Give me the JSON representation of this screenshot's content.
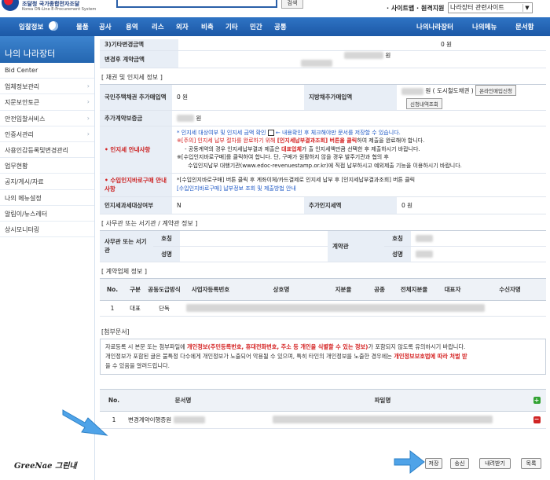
{
  "header": {
    "logo_title": "조달청 국가종합전자조달",
    "logo_subtitle": "Korea ON-Line E-Procurement System",
    "search_button": "검색",
    "top_links": "· 사이트맵 · 원격지원",
    "site_select": "나라장터 관련사이트"
  },
  "nav": {
    "items": [
      "입찰정보",
      "물품",
      "공사",
      "용역",
      "리스",
      "외자",
      "비축",
      "기타",
      "민간",
      "공통",
      "나의나라장터",
      "나의메뉴",
      "문서함"
    ]
  },
  "sidebar": {
    "title": "나의 나라장터",
    "items": [
      "Bid Center",
      "업체정보관리",
      "지문보안토큰",
      "안전입찰서비스",
      "인증서관리",
      "사용인감등록및변경관리",
      "업무현황",
      "공지/게시/자료",
      "나의 메뉴설정",
      "알림이/뉴스레터",
      "상시모니터링"
    ],
    "brand": "GreeNae 그린내"
  },
  "amounts": {
    "other_change_label": "3)기타변경금액",
    "other_change_value": "0 원",
    "after_change_label": "변경후 계약금액",
    "after_change_value": "원"
  },
  "bond": {
    "section_title": "[ 채권 및 인지세 정보 ]",
    "housing_label": "국민주택채권 추가매입액",
    "housing_value": "0 원",
    "local_label": "지방채추가매입액",
    "local_value": "원 ( 도시철도채권 )",
    "online_btn": "온라인매입신청",
    "history_btn": "신청내역조회",
    "extra_label": "추가계약보증금",
    "extra_value": "원",
    "stamp_label": "인지세 안내사항",
    "stamp_line1": "* 인지세 대상여부 및 인지세 금액 확인",
    "stamp_line1b": "← 내용확인 후 체크해야만 문서를 저장할 수 있습니다.",
    "stamp_line2a": "※[주의] 인지세 납부 절차를 완료하기 위해",
    "stamp_line2b": "[인지세납부결과조회] 버튼을 클릭",
    "stamp_line2c": "하여 제출을 완료해야 합니다.",
    "stamp_line3a": "- 공동계약의 경우 인지세납부결과 제출은",
    "stamp_line3b": "대표업체",
    "stamp_line3c": "가 출 인지세액만큼 선택한 후 제출하시기 바랍니다.",
    "stamp_line4": "※[수입인지바로구매]를 클릭하여 합니다. 단, 구매가 원활하지 않을 경우 발주기관과 협의 후",
    "stamp_line5": "수입인지납부 대행기관(www.edoc-revenuestamp.or.kr)에 직접 납부하시고 예외제출 기능을 이용하시기 바랍니다.",
    "buy_label": "수입인지바로구매 안내사항",
    "buy_line1": "*[수입인지바로구매] 버튼 클릭 후 계좌이체/카드결제로 인지세 납부 후 [인지세납부결과조회] 버튼 클릭",
    "buy_line2": "[수입인지바로구매] 납부정보 조회 및 제출방법 안내",
    "stamp_target_label": "인지세과세대상여부",
    "stamp_target_value": "N",
    "stamp_amount_label": "추가인지세액",
    "stamp_amount_value": "0 원"
  },
  "office": {
    "section_title": "[ 사무관 또는 서기관 / 계약관 정보 ]",
    "officer_label": "사무관 또는 서기관",
    "contractor_label": "계약관",
    "rank_label": "호칭",
    "name_label": "성명"
  },
  "company": {
    "section_title": "[ 계약업체 정보 ]",
    "headers": [
      "No.",
      "구분",
      "공동도급방식",
      "사업자등록번호",
      "상호명",
      "지분율",
      "공종",
      "전체지분율",
      "대표자",
      "수신자명"
    ],
    "row": [
      "1",
      "대표",
      "단독"
    ]
  },
  "attach": {
    "section_title": "[첨부문서]",
    "notice1a": "자료등록 시 본문 또는 첨부파일에",
    "notice1b": "개인정보(주민등록번호, 휴대전화번호, 주소 등 개인을 식별할 수 있는 정보)",
    "notice1c": "가 포함되지 않도록 유의하시기 바랍니다.",
    "notice2a": "개인정보가 포함된 글은 불특정 다수에게 개인정보가 노출되어 악용될 수 있으며, 특히 타인의 개인정보를 노출한 경우에는",
    "notice2b": "개인정보보호법에 따라 처벌 받",
    "notice2c": "을 수 있음을 알려드립니다.",
    "headers": [
      "No.",
      "문서명",
      "파일명"
    ],
    "row_no": "1",
    "row_doc": "변경계약이행증원"
  },
  "buttons": {
    "save": "저장",
    "send": "송신",
    "download": "내려받기",
    "list": "목록"
  }
}
